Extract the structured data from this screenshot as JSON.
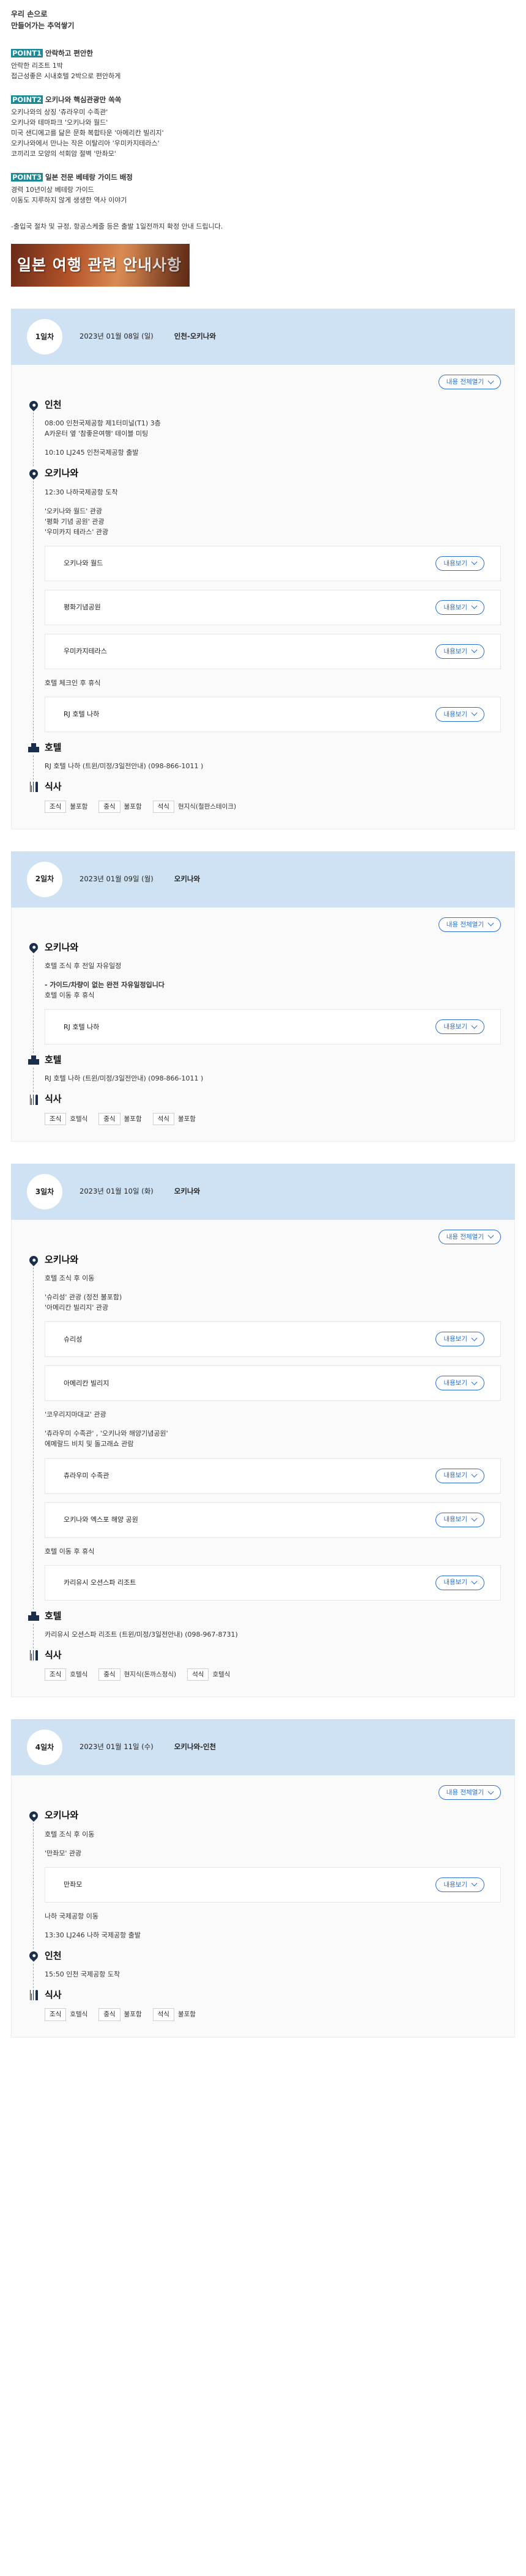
{
  "intro": {
    "title1": "우리 손으로",
    "title2": "만들어가는 추억쌓기",
    "points": [
      {
        "tag": "POINT1",
        "head": "안락하고 편안한",
        "lines": [
          "안락한 리조트 1박",
          "접근성좋은 시내호텔 2박으로 편안하게"
        ]
      },
      {
        "tag": "POINT2",
        "head": "오키나와 핵심관광만 쏙쏙",
        "lines": [
          "오키나와의 상징 '츄라우미 수족관'",
          "오키나와 테마파크 '오키나와 월드'",
          "미국 샌디에고를 닮은 문화 복합타운 '아메리칸 빌리지'",
          "오키나와에서 만나는 작은 이탈리아 '우미카지테라스'",
          "코끼리코 모양의 석회암 절벽 '만좌모'"
        ]
      },
      {
        "tag": "POINT3",
        "head": "일본 전문 베테랑 가이드 배정",
        "lines": [
          "경력 10년이상 베테랑 가이드",
          "이동도 지루하지 않게 생생한 역사 이야기"
        ]
      }
    ],
    "notice": "-출입국 절차 및 규정, 항공스케줄 등은 출발 1일전까지 확정 안내 드립니다.",
    "banner": "일본 여행 관련 안내사항"
  },
  "ui": {
    "toggle_all": "내용 전체열기",
    "more": "내용보기",
    "hotel_title": "호텔",
    "meal_title": "식사"
  },
  "days": [
    {
      "badge": "1일차",
      "date": "2023년 01월 08일 (일)",
      "route": "인천-오키나와",
      "places": [
        {
          "name": "인천",
          "blocks": [
            {
              "t": "text",
              "lines": [
                "08:00 인천국제공항 제1터미널(T1) 3층",
                "A카운터 옆 '참좋은여행' 테이블 미팅"
              ]
            },
            {
              "t": "gap"
            },
            {
              "t": "text",
              "lines": [
                "10:10 LJ245 인천국제공항 출발"
              ]
            }
          ]
        },
        {
          "name": "오키나와",
          "blocks": [
            {
              "t": "text",
              "lines": [
                "12:30 나하국제공항 도착"
              ]
            },
            {
              "t": "gap"
            },
            {
              "t": "text",
              "lines": [
                "'오키나와 월드' 관광",
                "'평화 기념 공원' 관광",
                "'우미카지 테라스' 관광"
              ]
            },
            {
              "t": "card",
              "name": "오키나와 월드"
            },
            {
              "t": "card",
              "name": "평화기념공원"
            },
            {
              "t": "card",
              "name": "우미카지테라스"
            },
            {
              "t": "text",
              "lines": [
                "호텔 체크인 후 휴식"
              ]
            },
            {
              "t": "card",
              "name": "RJ 호텔 나하"
            }
          ]
        }
      ],
      "hotel": "RJ 호텔 나하 (트윈/미정/3일전안내) (098-866-1011 )",
      "meals": [
        [
          "조식",
          "불포함"
        ],
        [
          "중식",
          "불포함"
        ],
        [
          "석식",
          "현지식(철판스테이크)"
        ]
      ]
    },
    {
      "badge": "2일차",
      "date": "2023년 01월 09일 (월)",
      "route": "오키나와",
      "places": [
        {
          "name": "오키나와",
          "blocks": [
            {
              "t": "text",
              "lines": [
                "호텔 조식 후 전일 자유일정"
              ]
            },
            {
              "t": "gap"
            },
            {
              "t": "textb",
              "lines": [
                "- 가이드/차량이 없는 완전 자유일정입니다"
              ]
            },
            {
              "t": "text",
              "lines": [
                "호텔 이동 후 휴식"
              ]
            },
            {
              "t": "card",
              "name": "RJ 호텔 나하"
            }
          ]
        }
      ],
      "hotel": "RJ 호텔 나하 (트윈/미정/3일전안내) (098-866-1011 )",
      "meals": [
        [
          "조식",
          "호텔식"
        ],
        [
          "중식",
          "불포함"
        ],
        [
          "석식",
          "불포함"
        ]
      ]
    },
    {
      "badge": "3일차",
      "date": "2023년 01월 10일 (화)",
      "route": "오키나와",
      "places": [
        {
          "name": "오키나와",
          "blocks": [
            {
              "t": "text",
              "lines": [
                "호텔 조식 후 이동"
              ]
            },
            {
              "t": "gap"
            },
            {
              "t": "text",
              "lines": [
                "'슈리성' 관광 (정전 불포함)",
                "'아메리칸 빌리지' 관광"
              ]
            },
            {
              "t": "card",
              "name": "슈리성"
            },
            {
              "t": "card",
              "name": "아메리칸 빌리지"
            },
            {
              "t": "text",
              "lines": [
                "'코우리지마대교' 관광"
              ]
            },
            {
              "t": "gap"
            },
            {
              "t": "text",
              "lines": [
                "'츄라우미 수족관' , '오키나와 해양기념공원'",
                "에메랄드 비치 및 돌고래쇼 관람"
              ]
            },
            {
              "t": "card",
              "name": "츄라우미 수족관"
            },
            {
              "t": "card",
              "name": "오키나와 엑스포 해양 공원"
            },
            {
              "t": "text",
              "lines": [
                "호텔 이동 후 휴식"
              ]
            },
            {
              "t": "card",
              "name": "카리유시 오션스파 리조트"
            }
          ]
        }
      ],
      "hotel": "카리유시 오션스파 리조트 (트윈/미정/3일전안내) (098-967-8731)",
      "meals": [
        [
          "조식",
          "호텔식"
        ],
        [
          "중식",
          "현지식(돈까스정식)"
        ],
        [
          "석식",
          "호텔식"
        ]
      ]
    },
    {
      "badge": "4일차",
      "date": "2023년 01월 11일 (수)",
      "route": "오키나와-인천",
      "places": [
        {
          "name": "오키나와",
          "blocks": [
            {
              "t": "text",
              "lines": [
                "호텔 조식 후 이동"
              ]
            },
            {
              "t": "gap"
            },
            {
              "t": "text",
              "lines": [
                "'만좌모' 관광"
              ]
            },
            {
              "t": "card",
              "name": "만좌모"
            },
            {
              "t": "text",
              "lines": [
                "나하 국제공항 이동"
              ]
            },
            {
              "t": "gap"
            },
            {
              "t": "text",
              "lines": [
                "13:30 LJ246 나하 국제공항 출발"
              ]
            }
          ]
        },
        {
          "name": "인천",
          "blocks": [
            {
              "t": "text",
              "lines": [
                "15:50 인천 국제공항 도착"
              ]
            }
          ]
        }
      ],
      "hotel": "",
      "meals": [
        [
          "조식",
          "호텔식"
        ],
        [
          "중식",
          "불포함"
        ],
        [
          "석식",
          "불포함"
        ]
      ]
    }
  ]
}
